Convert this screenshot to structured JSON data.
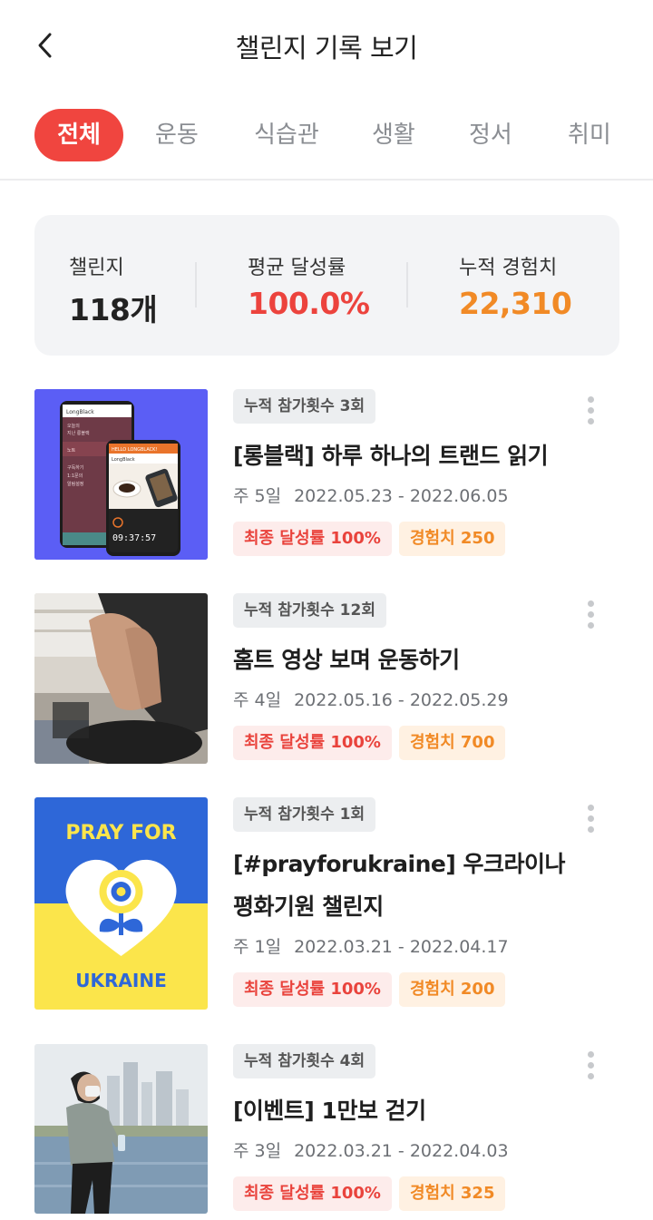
{
  "header": {
    "title": "챌린지 기록 보기",
    "back_icon": "chevron-left-icon"
  },
  "tabs": [
    {
      "label": "전체",
      "active": true
    },
    {
      "label": "운동",
      "active": false
    },
    {
      "label": "식습관",
      "active": false
    },
    {
      "label": "생활",
      "active": false
    },
    {
      "label": "정서",
      "active": false
    },
    {
      "label": "취미",
      "active": false
    }
  ],
  "summary": {
    "challenges": {
      "label": "챌린지",
      "value": "118개"
    },
    "avg_rate": {
      "label": "평균 달성률",
      "value": "100.0%"
    },
    "total_exp": {
      "label": "누적 경험치",
      "value": "22,310"
    }
  },
  "colors": {
    "accent_red": "#f0453f",
    "accent_orange": "#f18a26",
    "ukraine_blue": "#2e67d8",
    "ukraine_yellow": "#fbe54b"
  },
  "challenges": [
    {
      "participation": "누적 참가횟수 3회",
      "title": "[롱블랙] 하루 하나의 트랜드 읽기",
      "weeks": "주 5일",
      "period": "2022.05.23 - 2022.06.05",
      "rate": "최종 달성률 100%",
      "exp": "경험치 250",
      "thumb": {
        "brand": "LongBlack",
        "banner": "HELLO LONGBLACK!",
        "menu_1": "오늘의",
        "menu_2": "지난 롱블랙",
        "menu_3": "노트",
        "menu_4": "구독하기",
        "menu_5": "1:1문의",
        "menu_6": "알림설정",
        "timer": "09:37:57"
      }
    },
    {
      "participation": "누적 참가횟수 12회",
      "title": "홈트 영상 보며 운동하기",
      "weeks": "주 4일",
      "period": "2022.05.16 - 2022.05.29",
      "rate": "최종 달성률 100%",
      "exp": "경험치 700"
    },
    {
      "participation": "누적 참가횟수 1회",
      "title": "[#prayforukraine] 우크라이나 평화기원 챌린지",
      "weeks": "주 1일",
      "period": "2022.03.21 - 2022.04.17",
      "rate": "최종 달성률 100%",
      "exp": "경험치 200",
      "thumb": {
        "top_text": "PRAY FOR",
        "bottom_text": "UKRAINE"
      }
    },
    {
      "participation": "누적 참가횟수 4회",
      "title": "[이벤트] 1만보 걷기",
      "weeks": "주 3일",
      "period": "2022.03.21 - 2022.04.03",
      "rate": "최종 달성률 100%",
      "exp": "경험치 325"
    }
  ]
}
